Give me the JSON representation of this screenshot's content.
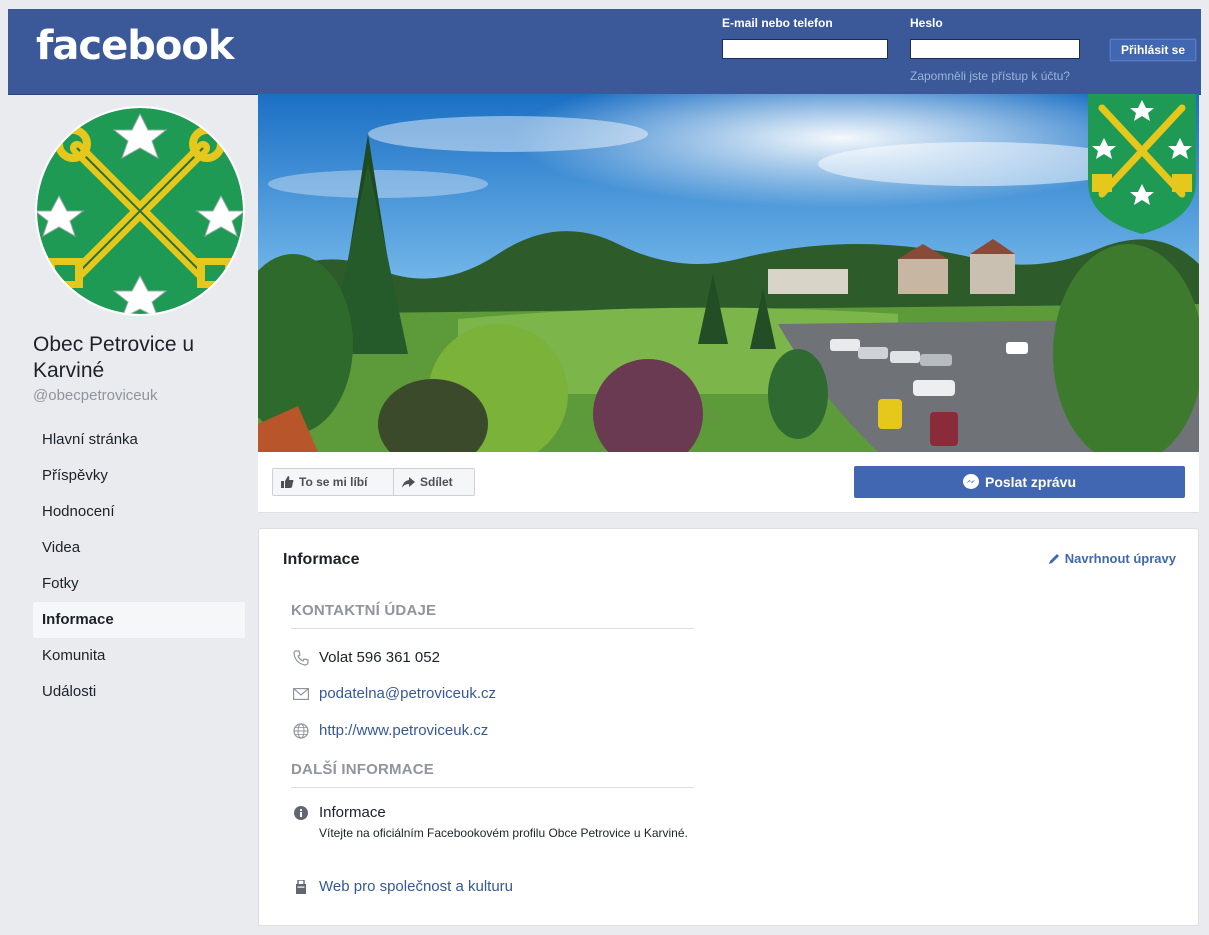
{
  "header": {
    "logo": "facebook",
    "email_label": "E-mail nebo telefon",
    "password_label": "Heslo",
    "login_button": "Přihlásit se",
    "forgot_link": "Zapomněli jste přístup k účtu?"
  },
  "page": {
    "name": "Obec Petrovice u Karviné",
    "handle": "@obecpetroviceuk"
  },
  "nav": {
    "items": [
      {
        "label": "Hlavní stránka"
      },
      {
        "label": "Příspěvky"
      },
      {
        "label": "Hodnocení"
      },
      {
        "label": "Videa"
      },
      {
        "label": "Fotky"
      },
      {
        "label": "Informace"
      },
      {
        "label": "Komunita"
      },
      {
        "label": "Události"
      }
    ],
    "active": "Informace"
  },
  "actions": {
    "like": "To se mi líbí",
    "share": "Sdílet",
    "message": "Poslat zprávu"
  },
  "info": {
    "title": "Informace",
    "edit_link": "Navrhnout úpravy",
    "contact_heading": "KONTAKTNÍ ÚDAJE",
    "phone": "Volat 596 361 052",
    "email": "podatelna@petroviceuk.cz",
    "website": "http://www.petroviceuk.cz",
    "more_heading": "DALŠÍ INFORMACE",
    "about_label": "Informace",
    "about_text": "Vítejte na oficiálním Facebookovém profilu Obce Petrovice u Karviné.",
    "category": "Web pro společnost a kulturu"
  },
  "colors": {
    "brand": "#3b5998",
    "button": "#4267b2",
    "link": "#365899",
    "crest_green": "#1f9a54",
    "crest_gold": "#e5c81b"
  }
}
